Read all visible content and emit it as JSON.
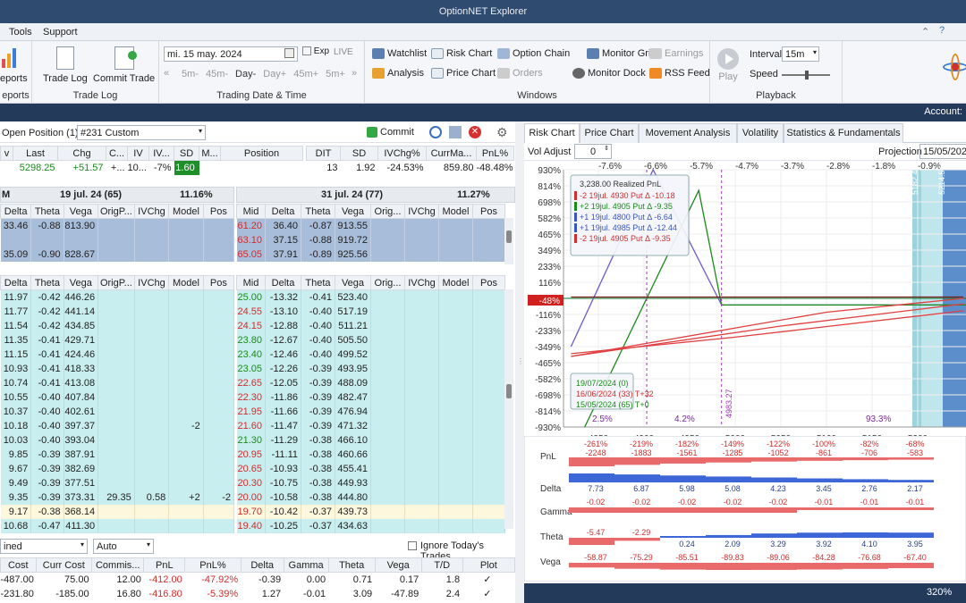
{
  "title": "OptionNET Explorer",
  "menu": [
    "Tools",
    "Support"
  ],
  "ribbon": {
    "reports": "eports",
    "reports2": "eports",
    "trade_log": "Trade Log",
    "commit_trade": "Commit Trade",
    "trade_log_group": "Trade Log",
    "date": "mi. 15 may. 2024",
    "exp": "Exp",
    "live": "LIVE",
    "steps": [
      "5m-",
      "45m-",
      "Day-",
      "Day+",
      "45m+",
      "5m+"
    ],
    "date_group": "Trading Date & Time",
    "watchlist": "Watchlist",
    "risk_chart": "Risk Chart",
    "option_chain": "Option Chain",
    "monitor_grid": "Monitor Grid",
    "earnings": "Earnings",
    "analysis": "Analysis",
    "price_chart": "Price Chart",
    "orders": "Orders",
    "monitor_dock": "Monitor Dock",
    "rss_feed": "RSS Feed",
    "windows_group": "Windows",
    "play": "Play",
    "interval_label": "Interval",
    "interval_value": "15m",
    "speed_label": "Speed",
    "playback_group": "Playback"
  },
  "account": "Account:",
  "position": {
    "label": "Open Position (1)",
    "value": "#231 Custom",
    "commit": "Commit"
  },
  "summary": {
    "cols1": [
      "v",
      "Last",
      "Chg",
      "C...",
      "IV",
      "IV...",
      "SD",
      "M...",
      "Position"
    ],
    "row1": [
      "",
      "5298.25",
      "+51.57",
      "+...",
      "10...",
      "-7%",
      "1.60",
      "",
      ""
    ],
    "cols2": [
      "DIT",
      "SD",
      "IVChg%",
      "CurrMa...",
      "PnL%"
    ],
    "row2": [
      "13",
      "1.92",
      "-24.53%",
      "859.80",
      "-48.48%"
    ]
  },
  "exp1": {
    "left": "M",
    "date": "19 jul. 24 (65)",
    "iv": "11.16%"
  },
  "exp2": {
    "date": "31 jul. 24 (77)",
    "iv": "11.27%"
  },
  "lcols": [
    "Delta",
    "Theta",
    "Vega",
    "OrigP...",
    "IVChg",
    "Model",
    "Pos"
  ],
  "rcols": [
    "Mid",
    "Delta",
    "Theta",
    "Vega",
    "Orig...",
    "IVChg",
    "Model",
    "Pos"
  ],
  "ltop": [
    [
      "33.46",
      "-0.88",
      "813.90",
      "",
      "",
      "",
      ""
    ],
    [
      "",
      "",
      "",
      "",
      "",
      "",
      ""
    ],
    [
      "35.09",
      "-0.90",
      "828.67",
      "",
      "",
      "",
      ""
    ]
  ],
  "rtop": [
    [
      "61.20",
      "36.40",
      "-0.87",
      "913.55",
      "",
      "",
      "",
      ""
    ],
    [
      "63.10",
      "37.15",
      "-0.88",
      "919.72",
      "",
      "",
      "",
      ""
    ],
    [
      "65.05",
      "37.91",
      "-0.89",
      "925.56",
      "",
      "",
      "",
      ""
    ]
  ],
  "lbot": [
    [
      "11.97",
      "-0.42",
      "446.26",
      "",
      "",
      "",
      ""
    ],
    [
      "11.77",
      "-0.42",
      "441.14",
      "",
      "",
      "",
      ""
    ],
    [
      "11.54",
      "-0.42",
      "434.85",
      "",
      "",
      "",
      ""
    ],
    [
      "11.35",
      "-0.41",
      "429.71",
      "",
      "",
      "",
      ""
    ],
    [
      "11.15",
      "-0.41",
      "424.46",
      "",
      "",
      "",
      ""
    ],
    [
      "10.93",
      "-0.41",
      "418.33",
      "",
      "",
      "",
      ""
    ],
    [
      "10.74",
      "-0.41",
      "413.08",
      "",
      "",
      "",
      ""
    ],
    [
      "10.55",
      "-0.40",
      "407.84",
      "",
      "",
      "",
      ""
    ],
    [
      "10.37",
      "-0.40",
      "402.61",
      "",
      "",
      "",
      ""
    ],
    [
      "10.18",
      "-0.40",
      "397.37",
      "",
      "",
      "-2",
      ""
    ],
    [
      "10.03",
      "-0.40",
      "393.04",
      "",
      "",
      "",
      ""
    ],
    [
      "9.85",
      "-0.39",
      "387.91",
      "",
      "",
      "",
      ""
    ],
    [
      "9.67",
      "-0.39",
      "382.69",
      "",
      "",
      "",
      ""
    ],
    [
      "9.49",
      "-0.39",
      "377.51",
      "",
      "",
      "",
      ""
    ],
    [
      "9.35",
      "-0.39",
      "373.31",
      "29.35",
      "0.58",
      "+2",
      "-2"
    ],
    [
      "9.17",
      "-0.38",
      "368.14",
      "",
      "",
      "",
      ""
    ],
    [
      "10.68",
      "-0.47",
      "411.30",
      "",
      "",
      "",
      ""
    ]
  ],
  "rbot": [
    [
      "25.00",
      "-13.32",
      "-0.41",
      "523.40",
      "",
      "",
      "",
      ""
    ],
    [
      "24.55",
      "-13.10",
      "-0.40",
      "517.19",
      "",
      "",
      "",
      ""
    ],
    [
      "24.15",
      "-12.88",
      "-0.40",
      "511.21",
      "",
      "",
      "",
      ""
    ],
    [
      "23.80",
      "-12.67",
      "-0.40",
      "505.50",
      "",
      "",
      "",
      ""
    ],
    [
      "23.40",
      "-12.46",
      "-0.40",
      "499.52",
      "",
      "",
      "",
      ""
    ],
    [
      "23.05",
      "-12.26",
      "-0.39",
      "493.95",
      "",
      "",
      "",
      ""
    ],
    [
      "22.65",
      "-12.05",
      "-0.39",
      "488.09",
      "",
      "",
      "",
      ""
    ],
    [
      "22.30",
      "-11.86",
      "-0.39",
      "482.47",
      "",
      "",
      "",
      ""
    ],
    [
      "21.95",
      "-11.66",
      "-0.39",
      "476.94",
      "",
      "",
      "",
      ""
    ],
    [
      "21.60",
      "-11.47",
      "-0.39",
      "471.32",
      "",
      "",
      "",
      ""
    ],
    [
      "21.30",
      "-11.29",
      "-0.38",
      "466.10",
      "",
      "",
      "",
      ""
    ],
    [
      "20.95",
      "-11.11",
      "-0.38",
      "460.66",
      "",
      "",
      "",
      ""
    ],
    [
      "20.65",
      "-10.93",
      "-0.38",
      "455.41",
      "",
      "",
      "",
      ""
    ],
    [
      "20.30",
      "-10.75",
      "-0.38",
      "449.93",
      "",
      "",
      "",
      ""
    ],
    [
      "20.00",
      "-10.58",
      "-0.38",
      "444.80",
      "",
      "",
      "",
      ""
    ],
    [
      "19.70",
      "-10.42",
      "-0.37",
      "439.73",
      "",
      "",
      "",
      ""
    ],
    [
      "19.40",
      "-10.25",
      "-0.37",
      "434.63",
      "",
      "",
      "",
      ""
    ]
  ],
  "bottom": {
    "sel1": "ined",
    "sel2": "Auto",
    "ignore": "Ignore Today's Trades",
    "cols": [
      "Cost",
      "Curr Cost",
      "Commis...",
      "PnL",
      "PnL%",
      "Delta",
      "Gamma",
      "Theta",
      "Vega",
      "T/D",
      "Plot"
    ],
    "rows": [
      [
        "-487.00",
        "75.00",
        "12.00",
        "-412.00",
        "-47.92%",
        "-0.39",
        "0.00",
        "0.71",
        "0.17",
        "1.8",
        "✓"
      ],
      [
        "-231.80",
        "-185.00",
        "16.80",
        "-416.80",
        "-5.39%",
        "1.27",
        "-0.01",
        "3.09",
        "-47.89",
        "2.4",
        "✓"
      ]
    ]
  },
  "tabs": [
    "Risk Chart",
    "Price Chart",
    "Movement Analysis",
    "Volatility",
    "Statistics & Fundamentals"
  ],
  "vol_adjust": {
    "label": "Vol Adjust",
    "value": "0"
  },
  "projection": {
    "label": "Projection",
    "value": "15/05/2024"
  },
  "pct_top": [
    "-7.6%",
    "-6.6%",
    "-5.7%",
    "-4.7%",
    "-3.7%",
    "-2.8%",
    "-1.8%",
    "-0.9%"
  ],
  "yticks": [
    "930%",
    "814%",
    "698%",
    "582%",
    "465%",
    "349%",
    "233%",
    "116%",
    "0%",
    "-116%",
    "-233%",
    "-349%",
    "-465%",
    "-582%",
    "-698%",
    "-814%",
    "-930%"
  ],
  "xticks": [
    "4850",
    "4900",
    "4950",
    "5000",
    "5050",
    "5100",
    "5150",
    "5200"
  ],
  "current_pnl": "-48%",
  "vlines": [
    "5182.40",
    "5214.54"
  ],
  "strike_label": "4983.27",
  "legend": {
    "title": "3,238.00 Realized PnL",
    "items": [
      "-2 19jul. 4930 Put Δ -10.18",
      "+2 19jul. 4905 Put Δ -9.35",
      "+1 19jul. 4800 Put Δ -6.64",
      "+1 19jul. 4985 Put Δ -12.44",
      "-2 19jul. 4905 Put Δ -9.35"
    ]
  },
  "dates_legend": [
    "19/07/2024 (0)",
    "16/06/2024 (33) T+32",
    "15/05/2024 (65) T+0"
  ],
  "probs": [
    "2.5%",
    "4.2%",
    "93.3%"
  ],
  "greeks": {
    "labels": [
      "PnL",
      "Delta",
      "Gamma",
      "Theta",
      "Vega"
    ],
    "pnlpct": [
      "-261%",
      "-219%",
      "-182%",
      "-149%",
      "-122%",
      "-100%",
      "-82%",
      "-68%"
    ],
    "pnl": [
      "-2248",
      "-1883",
      "-1561",
      "-1285",
      "-1052",
      "-861",
      "-706",
      "-583"
    ],
    "delta": [
      "7.73",
      "6.87",
      "5.98",
      "5.08",
      "4.23",
      "3.45",
      "2.76",
      "2.17"
    ],
    "gamma": [
      "-0.02",
      "-0.02",
      "-0.02",
      "-0.02",
      "-0.02",
      "-0.01",
      "-0.01",
      "-0.01"
    ],
    "theta": [
      "-5.47",
      "-2.29",
      "0.24",
      "2.09",
      "3.29",
      "3.92",
      "4.10",
      "3.95"
    ],
    "vega": [
      "-58.87",
      "-75.29",
      "-85.51",
      "-89.83",
      "-89.06",
      "-84.28",
      "-76.68",
      "-67.40"
    ]
  },
  "zoom": "320%",
  "colors": {
    "accent": "#233a5a",
    "pos_blue": "#a8bdd9",
    "pos_cyan": "#c9eef0",
    "loss": "#d42b2b",
    "gain": "#1a8a1a"
  }
}
